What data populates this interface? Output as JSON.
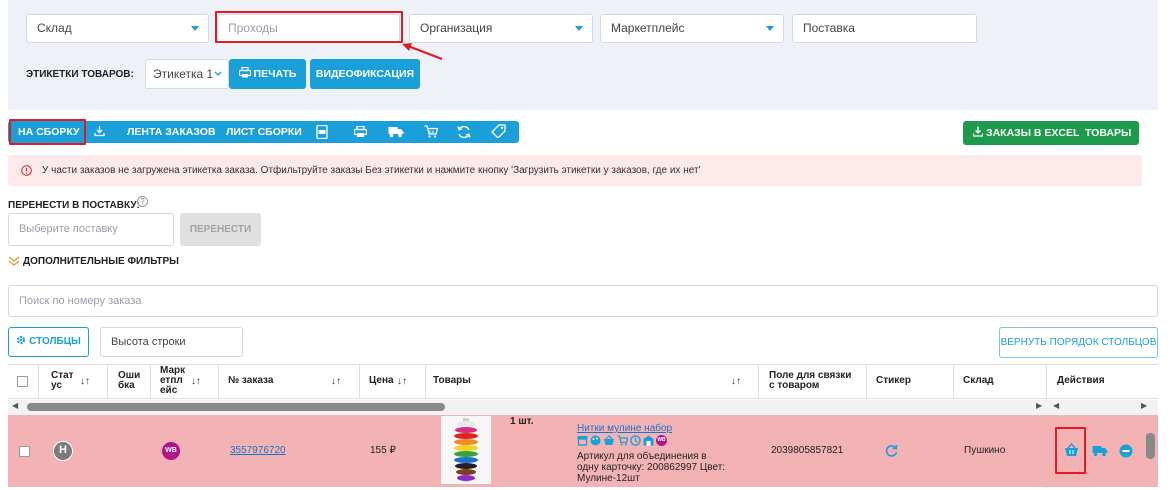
{
  "filters": {
    "warehouse": "Склад",
    "aisles_placeholder": "Проходы",
    "organization": "Организация",
    "marketplace": "Маркетплейс",
    "supply": "Поставка"
  },
  "labels": {
    "title": "ЭТИКЕТКИ ТОВАРОВ:",
    "select_value": "Этикетка 1",
    "print_button": "ПЕЧАТЬ",
    "video_button": "ВИДЕОФИКСАЦИЯ"
  },
  "toolbar": {
    "to_assembly": "НА СБОРКУ",
    "orders_feed": "ЛЕНТА ЗАКАЗОВ",
    "assembly_sheet": "ЛИСТ СБОРКИ",
    "orders_excel": "ЗАКАЗЫ В EXCEL",
    "goods": "ТОВАРЫ"
  },
  "alert": {
    "text": "У части заказов не загружена этикетка заказа. Отфильтруйте заказы Без этикетки и нажмите кнопку 'Загрузить этикетки у заказов, где их нет'"
  },
  "transfer": {
    "title": "ПЕРЕНЕСТИ В ПОСТАВКУ:",
    "help": "?",
    "placeholder": "Выберите поставку",
    "button": "ПЕРЕНЕСТИ"
  },
  "extra_filters": "ДОПОЛНИТЕЛЬНЫЕ ФИЛЬТРЫ",
  "search_placeholder": "Поиск по номеру заказа",
  "columns_button": "СТОЛБЦЫ",
  "row_height": "Высота строки",
  "reset_columns": "ВЕРНУТЬ ПОРЯДОК СТОЛБЦОВ",
  "table": {
    "headers": {
      "status": "Стат ус",
      "error": "Оши бка",
      "marketplace": "Марк етпл ейс",
      "order_no": "№ заказа",
      "price": "Цена",
      "goods": "Товары",
      "link_field": "Поле для связки с товаром",
      "sticker": "Стикер",
      "warehouse": "Склад",
      "actions": "Действия"
    },
    "row": {
      "status_letter": "Н",
      "mp_badge": "WB",
      "order_no": "3557976720",
      "price": "155 ₽",
      "qty": "1 шт.",
      "product_name": "Нитки мулине набор",
      "product_desc": "Артикул для объединения в одну карточку: 200862997 Цвет: Мулине-12шт",
      "link_value": "2039805857821",
      "warehouse": "Пушкино"
    }
  },
  "colors": {
    "accent": "#1a9fd9",
    "green": "#1d9a4b",
    "row_bg": "#f3b3b5",
    "alert_bg": "#fde8ea",
    "highlight": "#e01b24"
  }
}
